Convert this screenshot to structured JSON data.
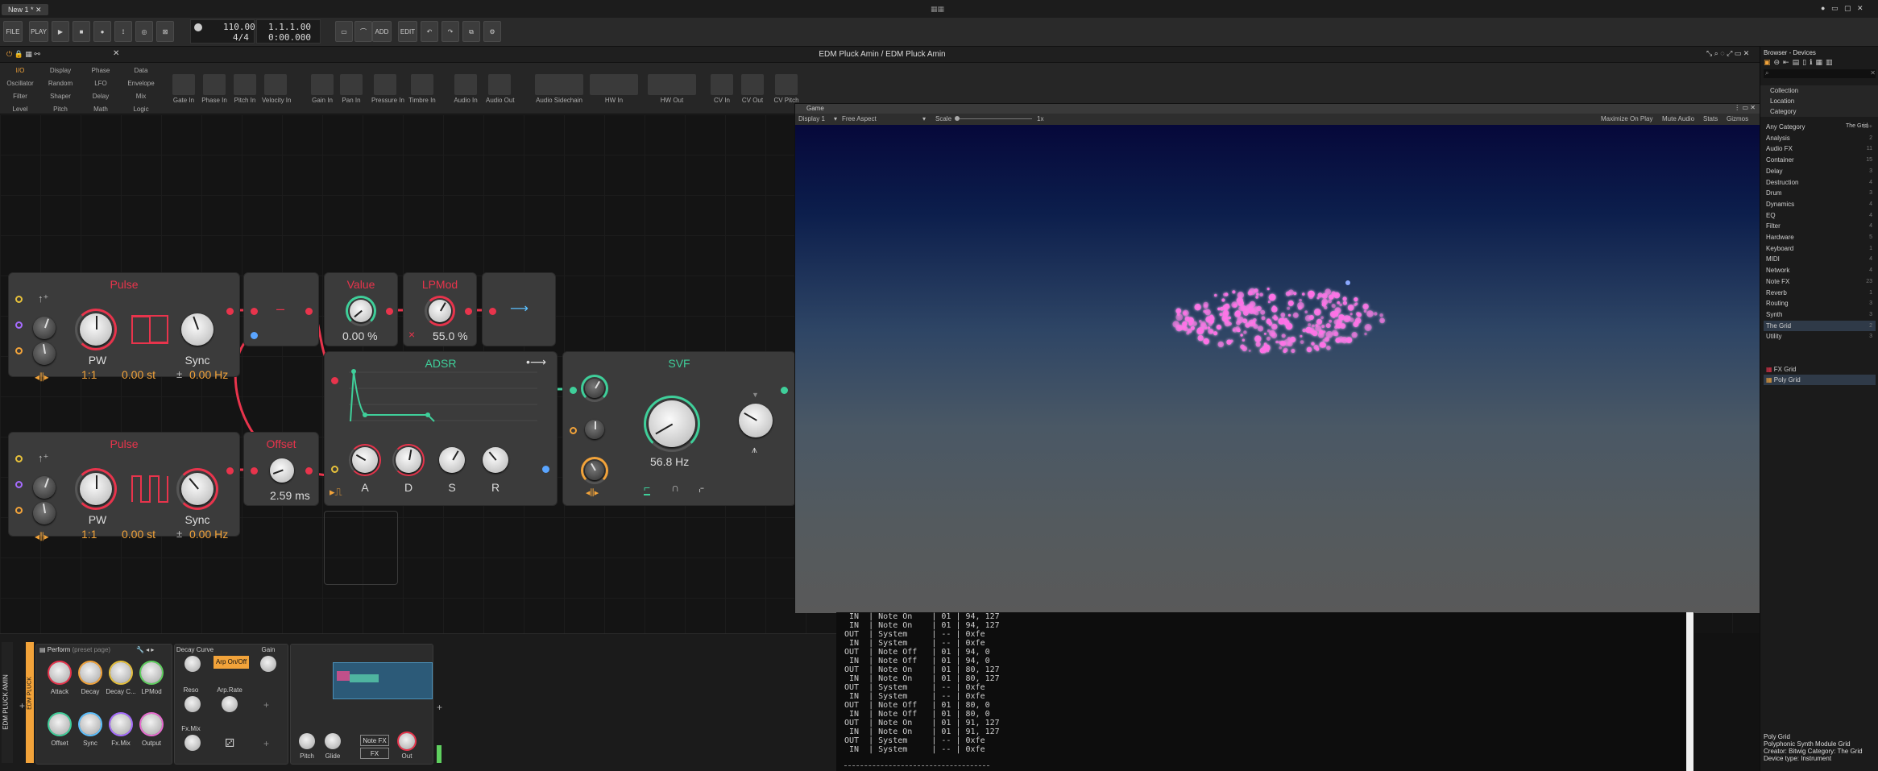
{
  "transport": {
    "tab_label": "New 1 *",
    "file_label": "FILE",
    "play_label": "PLAY",
    "tempo": "110.00",
    "signature": "4/4",
    "position": "1.1.1.00",
    "time": "0:00.000",
    "add_label": "ADD",
    "edit_label": "EDIT"
  },
  "editor": {
    "title": "EDM Pluck Amin / EDM Pluck Amin"
  },
  "palette": {
    "categories": [
      "I/O",
      "Display",
      "Phase",
      "Data",
      "Oscillator",
      "Random",
      "LFO",
      "Envelope",
      "Filter",
      "Shaper",
      "Delay",
      "Mix",
      "Level",
      "Pitch",
      "Math",
      "Logic"
    ],
    "items": [
      "Gate In",
      "Phase In",
      "Pitch In",
      "Velocity In",
      "Gain In",
      "Pan In",
      "Pressure In",
      "Timbre In",
      "Audio In",
      "Audio Out",
      "Audio Sidechain",
      "HW In",
      "HW Out",
      "CV In",
      "CV Out",
      "CV Pitch"
    ]
  },
  "modules": {
    "pulse1": {
      "title": "Pulse",
      "pw_label": "PW",
      "sync_label": "Sync",
      "ratio": "1:1",
      "semitones": "0.00 st",
      "hz": "0.00 Hz",
      "plusminus": "±"
    },
    "pulse2": {
      "title": "Pulse",
      "pw_label": "PW",
      "sync_label": "Sync",
      "ratio": "1:1",
      "semitones": "0.00 st",
      "hz": "0.00 Hz",
      "plusminus": "±"
    },
    "minus": {
      "symbol": "–"
    },
    "value": {
      "title": "Value",
      "readout": "0.00 %"
    },
    "lpmod": {
      "title": "LPMod",
      "readout": "55.0 %",
      "close": "×"
    },
    "offset": {
      "title": "Offset",
      "readout": "2.59 ms"
    },
    "adsr": {
      "title": "ADSR",
      "labels": [
        "A",
        "D",
        "S",
        "R"
      ]
    },
    "svf": {
      "title": "SVF",
      "readout": "56.8 Hz"
    }
  },
  "game": {
    "title": "Game",
    "display": "Display 1",
    "aspect": "Free Aspect",
    "scale_label": "Scale",
    "scale_value": "1x",
    "maximize": "Maximize On Play",
    "mute": "Mute Audio",
    "stats": "Stats",
    "gizmos": "Gizmos"
  },
  "console": {
    "lines": [
      " IN  | Note On    | 01 | 94, 127",
      " IN  | Note On    | 01 | 94, 127",
      "OUT  | System     | -- | 0xfe",
      " IN  | System     | -- | 0xfe",
      "OUT  | Note Off   | 01 | 94, 0",
      " IN  | Note Off   | 01 | 94, 0",
      "OUT  | Note On    | 01 | 80, 127",
      " IN  | Note On    | 01 | 80, 127",
      "OUT  | System     | -- | 0xfe",
      " IN  | System     | -- | 0xfe",
      "OUT  | Note Off   | 01 | 80, 0",
      " IN  | Note Off   | 01 | 80, 0",
      "OUT  | Note On    | 01 | 91, 127",
      " IN  | Note On    | 01 | 91, 127",
      "OUT  | System     | -- | 0xfe",
      " IN  | System     | -- | 0xfe"
    ]
  },
  "browser": {
    "title": "Browser - Devices",
    "sections": [
      "Collection",
      "Location",
      "Category"
    ],
    "category_filter": "The Grid",
    "categories": [
      {
        "name": "Any Category",
        "count": "99+"
      },
      {
        "name": "Analysis",
        "count": "2"
      },
      {
        "name": "Audio FX",
        "count": "11"
      },
      {
        "name": "Container",
        "count": "15"
      },
      {
        "name": "Delay",
        "count": "3"
      },
      {
        "name": "Destruction",
        "count": "4"
      },
      {
        "name": "Drum",
        "count": "3"
      },
      {
        "name": "Dynamics",
        "count": "4"
      },
      {
        "name": "EQ",
        "count": "4"
      },
      {
        "name": "Filter",
        "count": "4"
      },
      {
        "name": "Hardware",
        "count": "5"
      },
      {
        "name": "Keyboard",
        "count": "1"
      },
      {
        "name": "MIDI",
        "count": "4"
      },
      {
        "name": "Network",
        "count": "4"
      },
      {
        "name": "Note FX",
        "count": "23"
      },
      {
        "name": "Reverb",
        "count": "1"
      },
      {
        "name": "Routing",
        "count": "3"
      },
      {
        "name": "Synth",
        "count": "3"
      },
      {
        "name": "The Grid",
        "count": "2"
      },
      {
        "name": "Utility",
        "count": "3"
      }
    ],
    "results": [
      "FX Grid",
      "Poly Grid"
    ],
    "info_name": "Poly Grid",
    "info_desc": "Polyphonic Synth Module Grid",
    "info_creator": "Creator: Bitwig   Category: The Grid",
    "info_type": "Device type: Instrument"
  },
  "device": {
    "track_name": "EDM PLUCK AMIN",
    "sub_name": "EDM PLUCK",
    "page_label": "Perform",
    "page_hint": "(preset page)",
    "macros_top": [
      "Attack",
      "Decay",
      "Decay C...",
      "LPMod"
    ],
    "macros_bottom": [
      "Offset",
      "Sync",
      "Fx.Mix",
      "Output"
    ],
    "decay_curve": "Decay Curve",
    "arp_btn": "Arp On/Off",
    "gain": "Gain",
    "reso": "Reso",
    "arp_rate": "Arp.Rate",
    "fxmix": "Fx.Mix",
    "pitch": "Pitch",
    "glide": "Glide",
    "notefx": "Note FX",
    "fx": "FX",
    "out": "Out"
  }
}
